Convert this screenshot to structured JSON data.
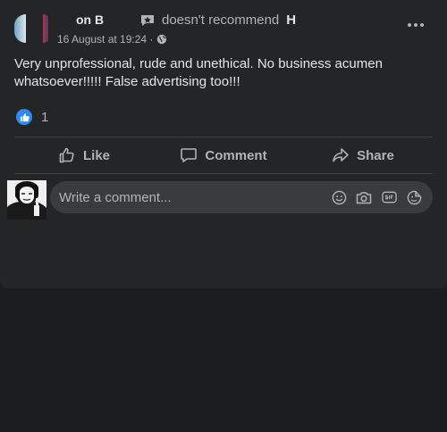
{
  "post": {
    "author_name": "on B",
    "recommend_text": "doesn't recommend",
    "recommend_target": "H",
    "timestamp": "16 August at 19:24 ·",
    "privacy_icon": "globe-icon",
    "body": "Very unprofessional, rude and unethical. No business acumen whatsoever!!!!! False advertising too!!!",
    "reaction_count": "1"
  },
  "actions": {
    "like_label": "Like",
    "comment_label": "Comment",
    "share_label": "Share"
  },
  "comment": {
    "placeholder": "Write a comment..."
  },
  "colors": {
    "accent": "#2e89ff",
    "card_bg": "#242526",
    "page_bg": "#1c1d1f"
  }
}
